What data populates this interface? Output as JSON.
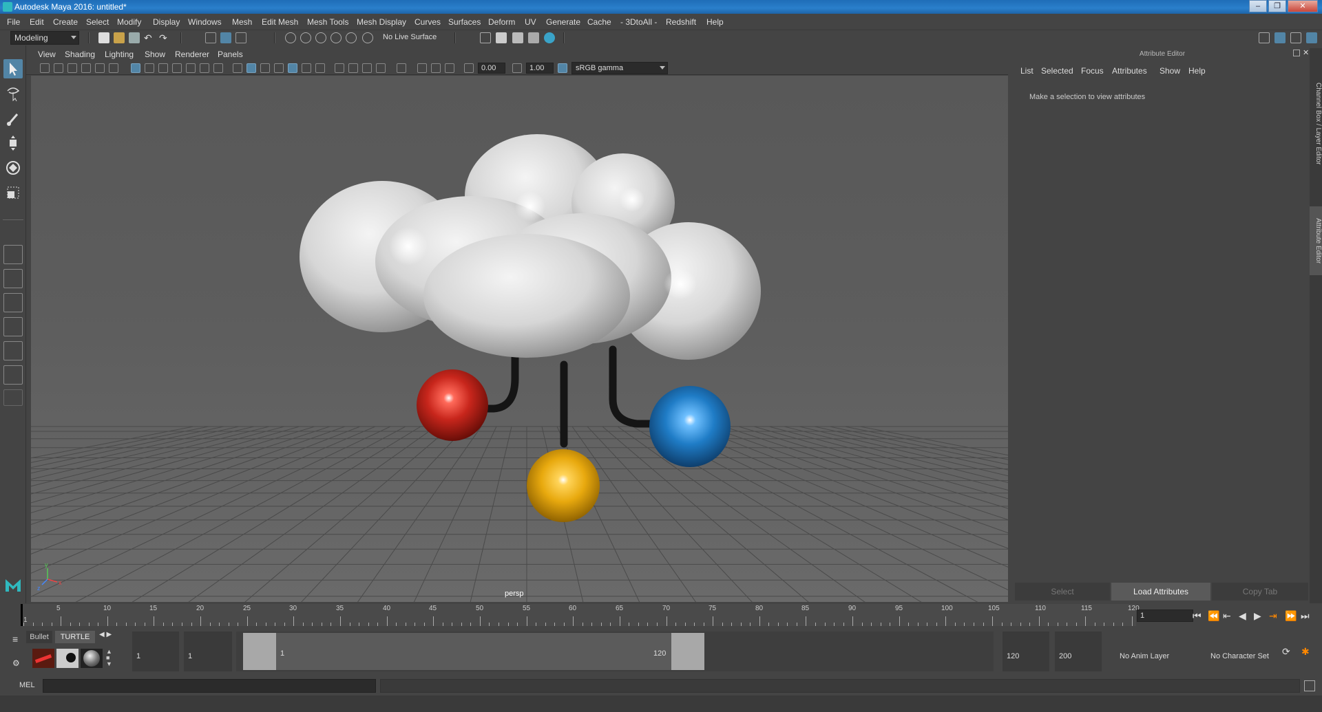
{
  "window": {
    "title": "Autodesk Maya 2016: untitled*"
  },
  "menubar": [
    "File",
    "Edit",
    "Create",
    "Select",
    "Modify",
    "Display",
    "Windows",
    "Mesh",
    "Edit Mesh",
    "Mesh Tools",
    "Mesh Display",
    "Curves",
    "Surfaces",
    "Deform",
    "UV",
    "Generate",
    "Cache",
    "- 3DtoAll -",
    "Redshift",
    "Help"
  ],
  "statusline": {
    "mode": "Modeling",
    "live_surface": "No Live Surface"
  },
  "viewport": {
    "menus": [
      "View",
      "Shading",
      "Lighting",
      "Show",
      "Renderer",
      "Panels"
    ],
    "exposure": "0.00",
    "gamma": "1.00",
    "color_space": "sRGB gamma",
    "camera_label": "persp",
    "axis_labels": {
      "x": "x",
      "y": "y",
      "z": "z"
    }
  },
  "attribute_editor": {
    "title": "Attribute Editor",
    "menus": [
      "List",
      "Selected",
      "Focus",
      "Attributes",
      "Show",
      "Help"
    ],
    "message": "Make a selection to view attributes",
    "buttons": {
      "select": "Select",
      "load": "Load Attributes",
      "copy": "Copy Tab"
    }
  },
  "side_tabs": {
    "channel_box": "Channel Box / Layer Editor",
    "attribute_editor": "Attribute Editor"
  },
  "timeslider": {
    "tick_labels": [
      "5",
      "10",
      "15",
      "20",
      "25",
      "30",
      "35",
      "40",
      "45",
      "50",
      "55",
      "60",
      "65",
      "70",
      "75",
      "80",
      "85",
      "90",
      "95",
      "100",
      "105",
      "110",
      "115",
      "120"
    ],
    "start_label": "1",
    "current_frame": "1"
  },
  "range": {
    "start": "1",
    "playback_start": "1",
    "range_start_label": "1",
    "range_end_label": "120",
    "playback_end": "120",
    "end": "200",
    "anim_layer": "No Anim Layer",
    "character_set": "No Character Set"
  },
  "shelf": {
    "tabs": [
      "Bullet",
      "TURTLE"
    ]
  },
  "command_line": {
    "language": "MEL"
  },
  "colors": {
    "accent": "#5285a6",
    "red_sphere": "#c8261c",
    "blue_sphere": "#1f7cc6",
    "yellow_sphere": "#e8a90e"
  }
}
